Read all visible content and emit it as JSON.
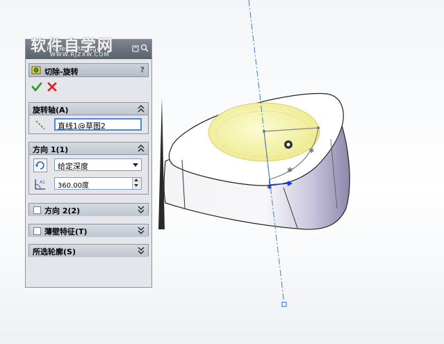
{
  "watermark": {
    "main": "软件自学网",
    "sub": "WWW.RJZXW.COM"
  },
  "panel": {
    "title": "PropertyManager",
    "feature": {
      "title": "切除-旋转",
      "help": "?"
    },
    "axis_group": {
      "title": "旋转轴(A)",
      "value": "直线1@草图2"
    },
    "direction1": {
      "title": "方向 1(1)",
      "end_condition": "给定深度",
      "angle": "360.00度"
    },
    "direction2": {
      "title": "方向 2(2)"
    },
    "thin_feature": {
      "title": "薄壁特征(T)"
    },
    "selected_contours": {
      "title": "所选轮廓(S)"
    }
  },
  "colors": {
    "ok": "#2f9a2f",
    "cancel": "#d42a2a",
    "axis_line": "#3a7fd0",
    "sketch_fill": "#f6f4a6",
    "part_shade": "#b9b3d0"
  }
}
